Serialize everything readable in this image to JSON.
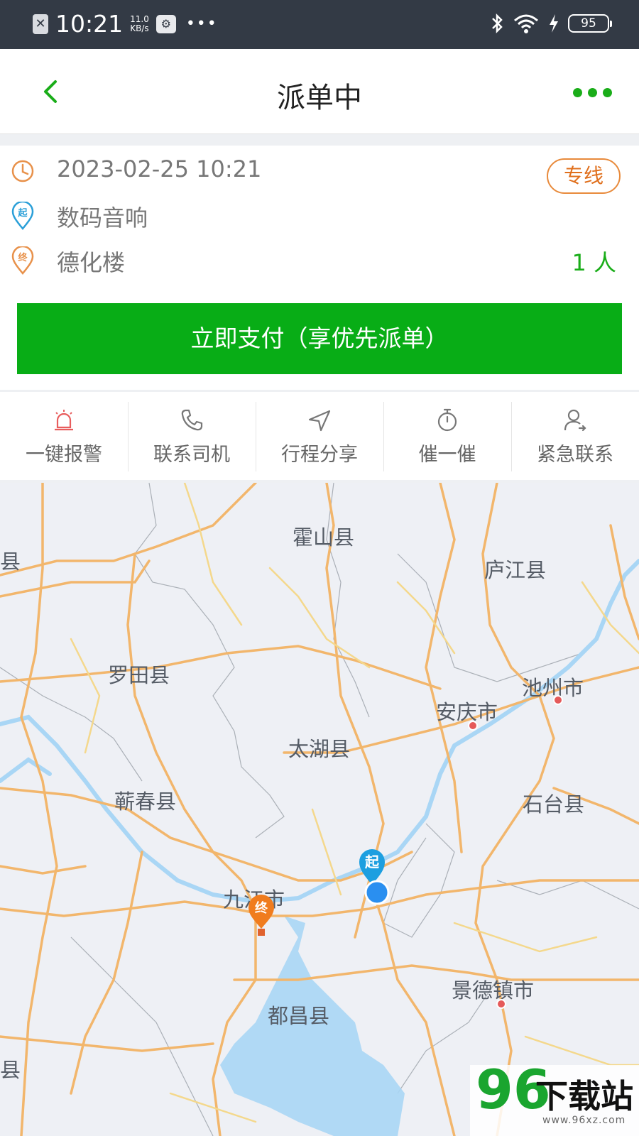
{
  "status_bar": {
    "time": "10:21",
    "speed_value": "11.0",
    "speed_unit": "KB/s",
    "battery": "95"
  },
  "header": {
    "title": "派单中",
    "accent": "#1aad19"
  },
  "order": {
    "datetime": "2023-02-25 10:21",
    "service_tag": "专线",
    "start_badge": "起",
    "end_badge": "终",
    "start": "数码音响",
    "end": "德化楼",
    "passengers": "1 人",
    "pay_label": "立即支付（享优先派单）",
    "pay_color": "#08ad16"
  },
  "actions": [
    {
      "label": "一键报警",
      "icon": "alarm-icon"
    },
    {
      "label": "联系司机",
      "icon": "phone-icon"
    },
    {
      "label": "行程分享",
      "icon": "share-arrow-icon"
    },
    {
      "label": "催一催",
      "icon": "stopwatch-icon"
    },
    {
      "label": "紧急联系",
      "icon": "contact-icon"
    }
  ],
  "map": {
    "cities": [
      "霍山县",
      "庐江县",
      "罗田县",
      "池州市",
      "安庆市",
      "太湖县",
      "蕲春县",
      "石台县",
      "九江市",
      "都昌县",
      "景德镇市",
      "县",
      "县"
    ],
    "start_marker": "起",
    "end_marker": "终"
  },
  "watermark": {
    "number": "96",
    "text": "下载站",
    "url": "www.96xz.com"
  }
}
